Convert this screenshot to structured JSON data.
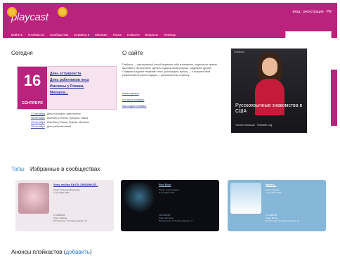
{
  "app": {
    "logo": "playcast",
    "top_links": "вход · регистрация · РФ",
    "nav": [
      "Войти ▸",
      "Плэйкасты",
      "Сообщества",
      "Сервисы ▸",
      "Магазин",
      "Поиск",
      "Новости",
      "Вопросы",
      "Помощь"
    ],
    "search_placeholder": ""
  },
  "today": {
    "heading": "Сегодня",
    "day": "16",
    "month": "СЕНТЯБРЯ",
    "holidays": [
      "День эстуаренста",
      "День работников леса",
      "Именины у Романа,",
      "Михаила..."
    ],
    "dates": [
      {
        "date": "17 сентября",
        "text": "День эстонского чайноголеса"
      },
      {
        "date": "18 сентября",
        "text": "Именины у Елены, Григория, Павла"
      },
      {
        "date": "19 сентября",
        "text": "Именины у Раисы, Кузьмы, Михаила"
      },
      {
        "date": "20 сентября",
        "text": "День рыбы мечтаний"
      }
    ]
  },
  "about": {
    "heading": "О сайте",
    "text": "Плэйкаст — оригинальный способ выразить себя в интернете, поделиться своими мыслями и настроением, сделать подарок своим родным, поздравить друзей. Соединяя в единое творение стихи, фотографии, музыку — и получите свой уникальный интернет-подарок — мультикарточку открытку.",
    "links": [
      "Начать делать",
      "Что такое плэйкаст",
      "Как создать плэйкаст"
    ]
  },
  "ad": {
    "tag": "Плэйкаст",
    "title": "Русскоязычные знакомства в США",
    "footer": "Узнать больше  ·  theirsite.org"
  },
  "tops": {
    "tab_active": "Топы",
    "tab_other": "Избранные в сообществах",
    "cards": [
      {
        "title": "Хочу любви БЫТЬ ЛЮБИМОЙ...",
        "meta": [
          "Автор: Гульмира Боранова",
          "1 сентября 2011"
        ],
        "footer": [
          "37 ЛАЙКОВ",
          "Тема: Любовь",
          "Просмотров: 11  Комментариев: 12"
        ]
      },
      {
        "title": "Red Blue",
        "meta": [
          "Автор: Александра А",
          "6 сентября 2011"
        ],
        "footer": [
          "19 ЛАЙКОВ",
          "Тема: Мистика",
          "Просмотров: 11  Комментариев: 12"
        ]
      },
      {
        "title": "Мечта...",
        "meta": [
          "Автор: Мария",
          "4 сентября 2011"
        ],
        "footer": [
          "37 ЛАЙКОВ",
          "Тема: Весна",
          "Просмотров: 11  Комментариев: 12"
        ]
      }
    ]
  },
  "announce": {
    "heading": "Анонсы плэйкастов (",
    "link": "добавить",
    "close": ")"
  }
}
